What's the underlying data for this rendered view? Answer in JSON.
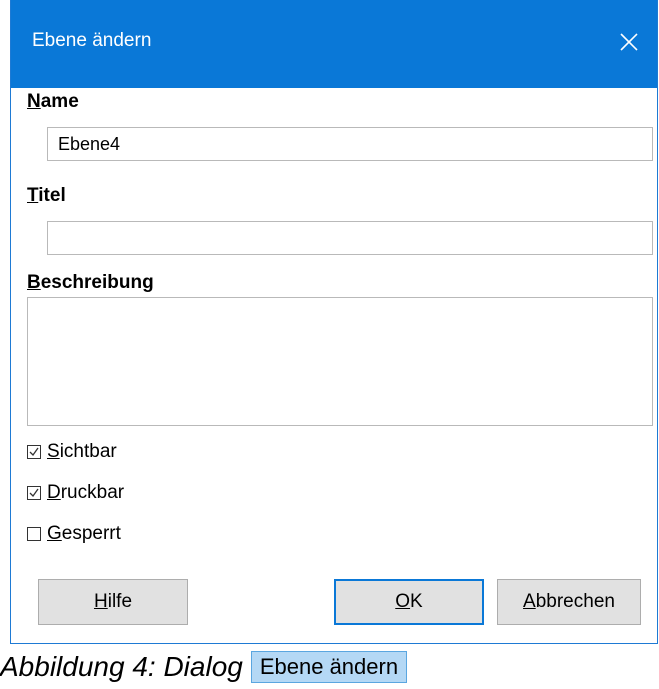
{
  "dialog": {
    "title": "Ebene ändern",
    "close_icon": "close-icon"
  },
  "fields": {
    "name": {
      "mnemonic": "N",
      "rest": "ame",
      "value": "Ebene4"
    },
    "titel": {
      "mnemonic": "T",
      "rest": "itel",
      "value": ""
    },
    "beschreibung": {
      "mnemonic": "B",
      "rest": "eschreibung",
      "value": ""
    }
  },
  "checkboxes": [
    {
      "mnemonic": "S",
      "rest": "ichtbar",
      "checked": true
    },
    {
      "mnemonic": "D",
      "rest": "ruckbar",
      "checked": true
    },
    {
      "mnemonic": "G",
      "rest": "esperrt",
      "checked": false
    }
  ],
  "buttons": {
    "help": {
      "mnemonic": "H",
      "rest": "ilfe"
    },
    "ok": {
      "mnemonic": "O",
      "rest": "K"
    },
    "cancel": {
      "mnemonic": "A",
      "rest": "bbrechen"
    }
  },
  "caption": {
    "text": "Abbildung 4: Dialog",
    "badge": "Ebene ändern"
  },
  "colors": {
    "titlebar": "#0a78d7",
    "default_button_border": "#0a78d7",
    "caption_badge": "#b4d8f5"
  }
}
